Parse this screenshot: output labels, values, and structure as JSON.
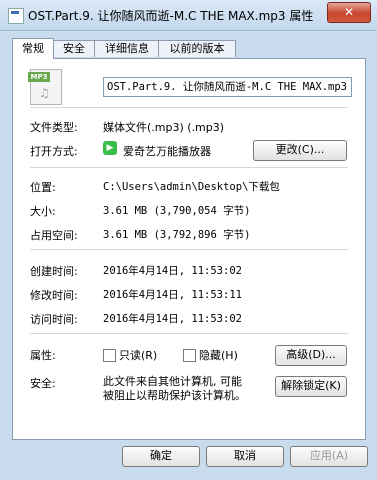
{
  "window": {
    "title": "OST.Part.9. 让你随风而逝-M.C THE MAX.mp3 属性",
    "close_glyph": "✕"
  },
  "tabs": [
    {
      "label": "常规",
      "active": true
    },
    {
      "label": "安全",
      "active": false
    },
    {
      "label": "详细信息",
      "active": false
    },
    {
      "label": "以前的版本",
      "active": false
    }
  ],
  "file": {
    "icon_badge": "MP3",
    "name": "OST.Part.9. 让你随风而逝-M.C THE MAX.mp3"
  },
  "fields": {
    "type_label": "文件类型:",
    "type_value": "媒体文件(.mp3) (.mp3)",
    "open_label": "打开方式:",
    "open_value": "爱奇艺万能播放器",
    "change_button": "更改(C)...",
    "location_label": "位置:",
    "location_value": "C:\\Users\\admin\\Desktop\\下载包",
    "size_label": "大小:",
    "size_value": "3.61 MB (3,790,054 字节)",
    "disk_size_label": "占用空间:",
    "disk_size_value": "3.61 MB (3,792,896 字节)",
    "created_label": "创建时间:",
    "created_value": "2016年4月14日, 11:53:02",
    "modified_label": "修改时间:",
    "modified_value": "2016年4月14日, 11:53:11",
    "accessed_label": "访问时间:",
    "accessed_value": "2016年4月14日, 11:53:02",
    "attributes_label": "属性:",
    "readonly_label": "只读(R)",
    "hidden_label": "隐藏(H)",
    "advanced_button": "高级(D)...",
    "security_label": "安全:",
    "security_text_1": "此文件来自其他计算机, 可能",
    "security_text_2": "被阻止以帮助保护该计算机。",
    "unblock_button": "解除锁定(K)"
  },
  "buttons": {
    "ok": "确定",
    "cancel": "取消",
    "apply": "应用(A)"
  }
}
